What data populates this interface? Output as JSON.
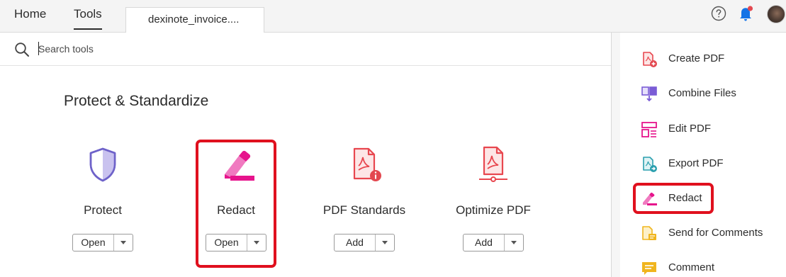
{
  "topbar": {
    "home_label": "Home",
    "tools_label": "Tools",
    "doc_tab_label": "dexinote_invoice...."
  },
  "search": {
    "placeholder": "Search tools",
    "value": ""
  },
  "main": {
    "section_title": "Protect & Standardize",
    "tools": [
      {
        "label": "Protect",
        "button": "Open"
      },
      {
        "label": "Redact",
        "button": "Open"
      },
      {
        "label": "PDF Standards",
        "button": "Add"
      },
      {
        "label": "Optimize PDF",
        "button": "Add"
      }
    ]
  },
  "right_panel": {
    "items": [
      {
        "label": "Create PDF",
        "icon": "create-pdf-icon"
      },
      {
        "label": "Combine Files",
        "icon": "combine-files-icon"
      },
      {
        "label": "Edit PDF",
        "icon": "edit-pdf-icon"
      },
      {
        "label": "Export PDF",
        "icon": "export-pdf-icon"
      },
      {
        "label": "Redact",
        "icon": "redact-icon"
      },
      {
        "label": "Send for Comments",
        "icon": "send-for-comments-icon"
      },
      {
        "label": "Comment",
        "icon": "comment-icon"
      }
    ]
  },
  "colors": {
    "highlight": "#e0101e",
    "pdf_red": "#e8474f",
    "redact_pink": "#e6148c",
    "combine_purple": "#7a5cd6",
    "export_teal": "#2a9fae",
    "send_yellow": "#f0b51e"
  }
}
